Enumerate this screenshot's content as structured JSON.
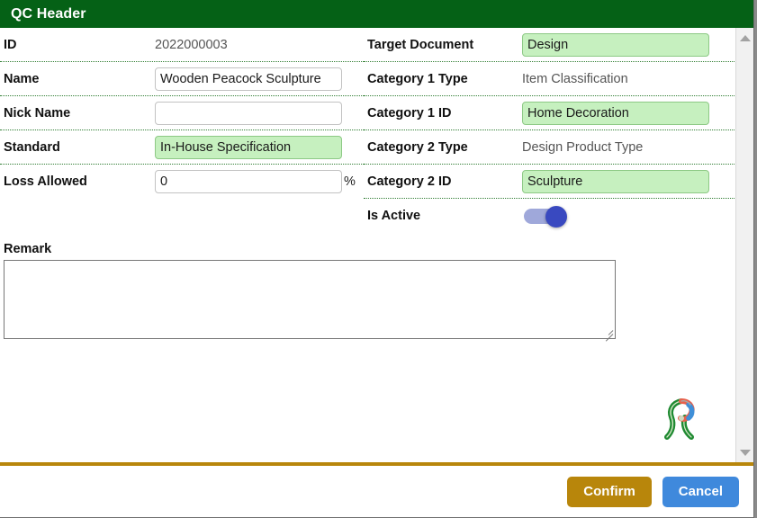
{
  "dialog": {
    "title": "QC Header"
  },
  "form": {
    "left": [
      {
        "label": "ID",
        "type": "text",
        "value": "2022000003",
        "green": false
      },
      {
        "label": "Name",
        "type": "input",
        "value": "Wooden Peacock Sculpture",
        "green": false
      },
      {
        "label": "Nick Name",
        "type": "input",
        "value": "",
        "green": false
      },
      {
        "label": "Standard",
        "type": "input",
        "value": "In-House Specification",
        "green": true
      },
      {
        "label": "Loss Allowed",
        "type": "input",
        "value": "0",
        "green": false,
        "suffix": "%"
      }
    ],
    "right": [
      {
        "label": "Target Document",
        "type": "input",
        "value": "Design",
        "green": true
      },
      {
        "label": "Category 1 Type",
        "type": "text",
        "value": "Item Classification",
        "green": false
      },
      {
        "label": "Category 1 ID",
        "type": "input",
        "value": "Home Decoration",
        "green": true
      },
      {
        "label": "Category 2 Type",
        "type": "text",
        "value": "Design Product Type",
        "green": false
      },
      {
        "label": "Category 2 ID",
        "type": "input",
        "value": "Sculpture",
        "green": true
      },
      {
        "label": "Is Active",
        "type": "toggle",
        "value": "on",
        "green": false
      }
    ]
  },
  "remark": {
    "label": "Remark",
    "value": "",
    "placeholder": ""
  },
  "footer": {
    "confirm_label": "Confirm",
    "cancel_label": "Cancel"
  },
  "icons": {
    "scroll_up": "chevron-up-icon",
    "scroll_down": "chevron-down-icon",
    "logo": "company-peacock-logo"
  },
  "colors": {
    "header_green": "#056116",
    "field_green_bg": "#c6f0bf",
    "field_green_border": "#8dc985",
    "confirm_gold": "#b8860b",
    "cancel_blue": "#3f89dc",
    "toggle_track": "#9fa8da",
    "toggle_knob": "#3949c0",
    "divider_gold": "#b8860b",
    "separator_green": "#2f7d32"
  }
}
